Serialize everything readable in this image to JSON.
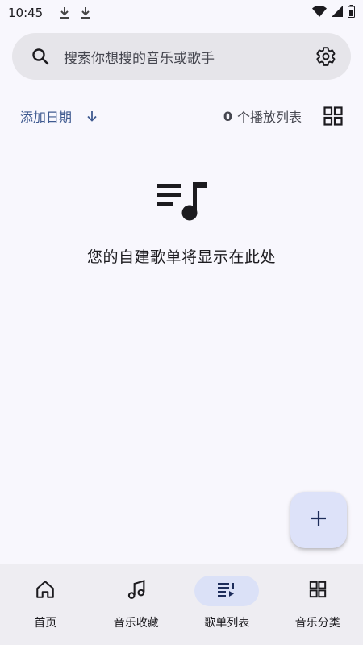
{
  "status_bar": {
    "time": "10:45"
  },
  "search": {
    "placeholder": "搜索你想搜的音乐或歌手"
  },
  "sort": {
    "label": "添加日期"
  },
  "playlist_count": {
    "number": "0",
    "label": "个播放列表"
  },
  "empty_state": {
    "message": "您的自建歌单将显示在此处"
  },
  "nav": {
    "items": [
      {
        "label": "首页",
        "icon": "home-icon"
      },
      {
        "label": "音乐收藏",
        "icon": "music-note-icon"
      },
      {
        "label": "歌单列表",
        "icon": "playlist-icon",
        "active": true
      },
      {
        "label": "音乐分类",
        "icon": "grid-icon"
      }
    ]
  },
  "colors": {
    "background": "#f8f7fd",
    "accent": "#3f5a90",
    "fab": "#dde2f9",
    "nav_active": "#dbe1f7"
  }
}
